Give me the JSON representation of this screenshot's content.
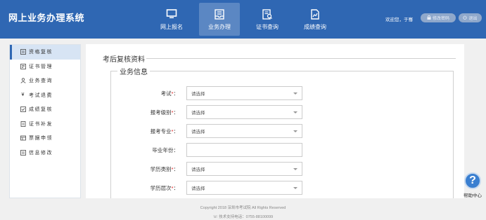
{
  "header": {
    "title": "网上业务办理系统",
    "nav": [
      {
        "label": "网上报名",
        "icon": "monitor-icon"
      },
      {
        "label": "业务办理",
        "icon": "inbox-icon"
      },
      {
        "label": "证书查询",
        "icon": "certificate-search-icon"
      },
      {
        "label": "成绩查询",
        "icon": "score-chart-icon"
      }
    ],
    "active_nav": "业务办理",
    "welcome": "欢迎您，于骞",
    "change_password": "修改密码",
    "exit": "退出"
  },
  "sidebar": {
    "items": [
      {
        "label": "资格复核",
        "icon": "review-icon"
      },
      {
        "label": "证书管理",
        "icon": "certificate-icon"
      },
      {
        "label": "业务查询",
        "icon": "business-query-icon"
      },
      {
        "label": "考试退费",
        "icon": "yen-icon"
      },
      {
        "label": "成绩复核",
        "icon": "checklist-icon"
      },
      {
        "label": "证书补发",
        "icon": "reissue-icon"
      },
      {
        "label": "票据申领",
        "icon": "receipt-icon"
      },
      {
        "label": "信息修改",
        "icon": "edit-info-icon"
      }
    ],
    "active": "资格复核"
  },
  "main": {
    "section_title": "考后复核资料",
    "subsection_title": "业务信息",
    "fields": [
      {
        "label": "考试",
        "required": true,
        "type": "select",
        "value": "请选择"
      },
      {
        "label": "报考级别",
        "required": true,
        "type": "select",
        "value": "请选择"
      },
      {
        "label": "报考专业",
        "required": true,
        "type": "select",
        "value": "请选择"
      },
      {
        "label": "毕业年份",
        "required": false,
        "type": "text",
        "value": ""
      },
      {
        "label": "学历类别",
        "required": true,
        "type": "select",
        "value": "请选择"
      },
      {
        "label": "学历层次",
        "required": true,
        "type": "select",
        "value": "请选择"
      }
    ]
  },
  "footer": {
    "copyright": "Copyright 2018 深圳市考试院 All Rights Reserved",
    "support": "技术支持电话：0755-88100099"
  },
  "help": {
    "label": "帮助中心"
  },
  "colors": {
    "brand": "#2f67b3",
    "required": "#e02020",
    "active_nav": "#5b87c3"
  }
}
